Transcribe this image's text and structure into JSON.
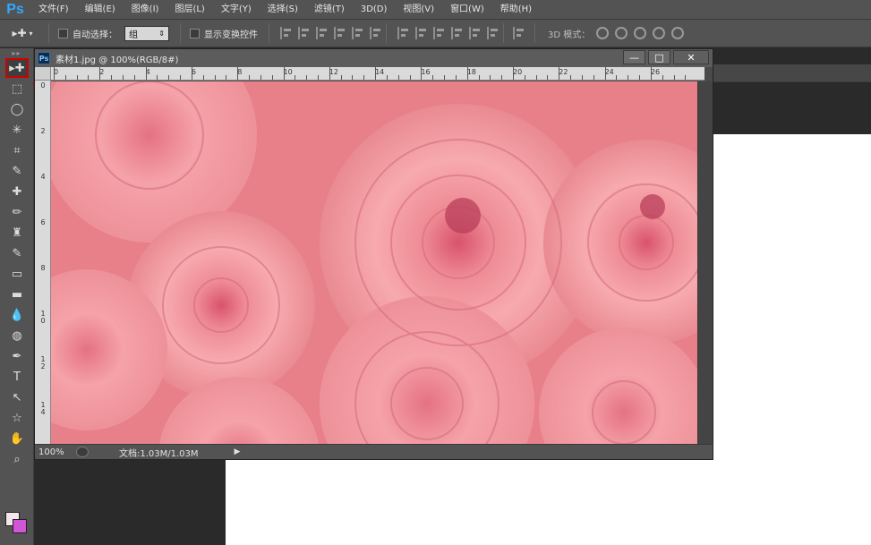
{
  "app": {
    "logo": "Ps"
  },
  "menu": [
    "文件(F)",
    "编辑(E)",
    "图像(I)",
    "图层(L)",
    "文字(Y)",
    "选择(S)",
    "滤镜(T)",
    "3D(D)",
    "视图(V)",
    "窗口(W)",
    "帮助(H)"
  ],
  "options": {
    "tool_preset_icon": "move-tool-icon",
    "auto_select_label": "自动选择：",
    "auto_select_value": "组",
    "show_transform_label": "显示变换控件",
    "mode_3d_label": "3D 模式："
  },
  "document": {
    "title": "素材1.jpg @ 100%(RGB/8#)",
    "icon_text": "Ps",
    "zoom": "100%",
    "doc_info": "文档:1.03M/1.03M",
    "ruler_h_labels": [
      "0",
      "2",
      "4",
      "6",
      "8",
      "10",
      "12",
      "14",
      "16",
      "18",
      "20",
      "22",
      "24",
      "26"
    ],
    "ruler_v_labels": [
      "0",
      "2",
      "4",
      "6",
      "8",
      "1 0",
      "1 2",
      "1 4"
    ]
  },
  "window_buttons": {
    "minimize": "—",
    "restore": "□",
    "close": "✕"
  },
  "colors": {
    "accent": "#31a8ff",
    "highlight": "#d10000",
    "foreground": "#f4e7ec",
    "background": "#d255d8"
  },
  "tools": [
    "move-tool",
    "marquee-tool",
    "lasso-tool",
    "magic-wand-tool",
    "crop-tool",
    "eyedropper-tool",
    "healing-brush-tool",
    "brush-tool",
    "clone-stamp-tool",
    "history-brush-tool",
    "eraser-tool",
    "gradient-tool",
    "blur-tool",
    "dodge-tool",
    "pen-tool",
    "type-tool",
    "path-selection-tool",
    "shape-tool",
    "hand-tool",
    "zoom-tool"
  ],
  "tool_glyphs": [
    "▸✚",
    "⬚",
    "◯",
    "✳",
    "⌗",
    "✎",
    "✚",
    "✏",
    "♜",
    "✎",
    "▭",
    "▬",
    "💧",
    "◍",
    "✒",
    "T",
    "↖",
    "☆",
    "✋",
    "⌕"
  ]
}
